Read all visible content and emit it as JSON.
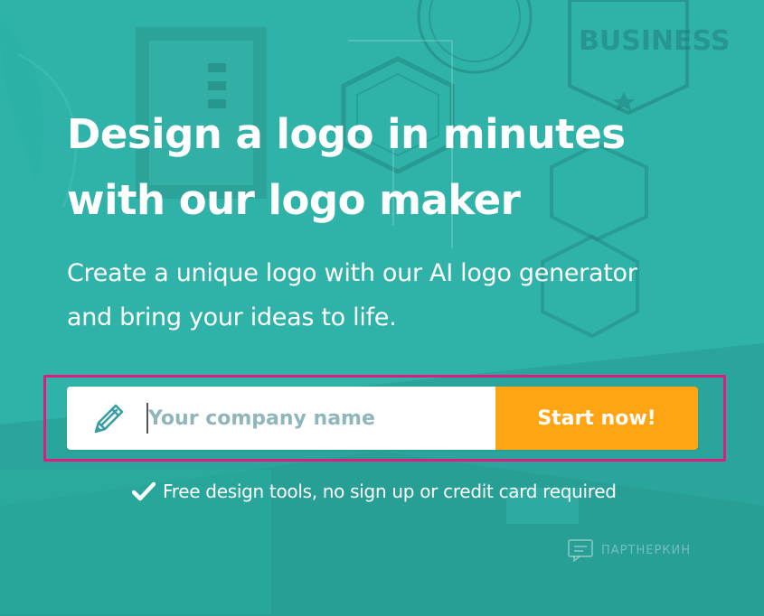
{
  "hero": {
    "headline_line1": "Design a logo in minutes",
    "headline_line2": "with our logo maker",
    "subhead_line1": "Create a unique logo with our AI logo generator",
    "subhead_line2": "and bring your ideas to life."
  },
  "form": {
    "input_placeholder": "Your company name",
    "input_value": "",
    "input_icon": "pencil-icon",
    "button_label": "Start now!"
  },
  "note": {
    "icon": "checkmark-icon",
    "text": "Free design tools, no sign up or credit card required"
  },
  "watermark": {
    "text": "ПАРТНЕРКИН"
  },
  "colors": {
    "background_teal": "#2aaaa0",
    "button_orange": "#ffa412",
    "highlight_magenta": "#e01a7e",
    "placeholder_gray": "#8fb7bb",
    "pencil_teal": "#3a9ea3"
  }
}
